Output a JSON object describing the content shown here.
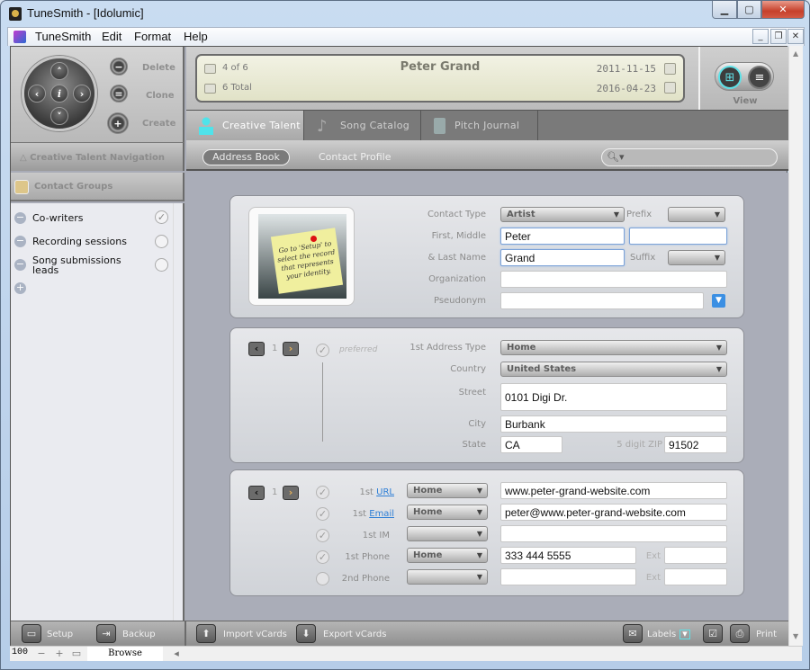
{
  "window": {
    "title": "TuneSmith - [Idolumic]"
  },
  "menu": [
    "TuneSmith",
    "Edit",
    "Format",
    "Help"
  ],
  "left_actions": {
    "delete": "Delete",
    "clone": "Clone",
    "create": "Create"
  },
  "record_bar": {
    "position": "4 of 6",
    "total": "6 Total",
    "name": "Peter Grand",
    "created": "2011-11-15",
    "modified": "2016-04-23"
  },
  "view": {
    "label": "View"
  },
  "tabs": [
    {
      "label": "Creative Talent",
      "active": true
    },
    {
      "label": "Song Catalog"
    },
    {
      "label": "Pitch Journal"
    }
  ],
  "subnav": {
    "address_book": "Address Book",
    "contact_profile": "Contact Profile"
  },
  "search": {
    "placeholder": ""
  },
  "sidebar": {
    "nav_title": "Creative Talent Navigation",
    "groups_title": "Contact Groups",
    "groups": [
      {
        "label": "Co-writers",
        "checked": true
      },
      {
        "label": "Recording sessions",
        "checked": false
      },
      {
        "label": "Song submissions leads",
        "checked": false
      }
    ]
  },
  "identity": {
    "photo_note": "Go to 'Setup' to select the record that represents your identity.",
    "labels": {
      "contact_type": "Contact Type",
      "prefix": "Prefix",
      "first_middle": "First, Middle",
      "last_name": "& Last Name",
      "suffix": "Suffix",
      "organization": "Organization",
      "pseudonym": "Pseudonym"
    },
    "values": {
      "contact_type": "Artist",
      "prefix": "",
      "first": "Peter",
      "middle": "",
      "last": "Grand",
      "suffix": "",
      "organization": "",
      "pseudonym": ""
    }
  },
  "address": {
    "page": "1",
    "preferred": "preferred",
    "labels": {
      "type": "1st Address Type",
      "country": "Country",
      "street": "Street",
      "city": "City",
      "state": "State",
      "zip": "5 digit ZIP"
    },
    "values": {
      "type": "Home",
      "country": "United States",
      "street": "0101 Digi Dr.",
      "city": "Burbank",
      "state": "CA",
      "zip": "91502"
    }
  },
  "contact": {
    "page": "1",
    "rows": [
      {
        "prefix": "1st ",
        "label": "URL",
        "link": true,
        "type": "Home",
        "value": "www.peter-grand-website.com",
        "checked": true
      },
      {
        "prefix": "1st ",
        "label": "Email",
        "link": true,
        "type": "Home",
        "value": "peter@www.peter-grand-website.com",
        "checked": true
      },
      {
        "prefix": "",
        "label": "1st IM",
        "link": false,
        "type": "",
        "value": "",
        "checked": true
      },
      {
        "prefix": "",
        "label": "1st Phone",
        "link": false,
        "type": "Home",
        "value": "333 444 5555",
        "checked": true,
        "ext": ""
      },
      {
        "prefix": "",
        "label": "2nd Phone",
        "link": false,
        "type": "",
        "value": "",
        "checked": false,
        "ext": ""
      }
    ],
    "ext_label": "Ext"
  },
  "bottom": {
    "setup": "Setup",
    "backup": "Backup",
    "import": "Import vCards",
    "export": "Export vCards",
    "labels": "Labels",
    "print": "Print"
  },
  "status": {
    "zoom": "100",
    "mode": "Browse"
  }
}
